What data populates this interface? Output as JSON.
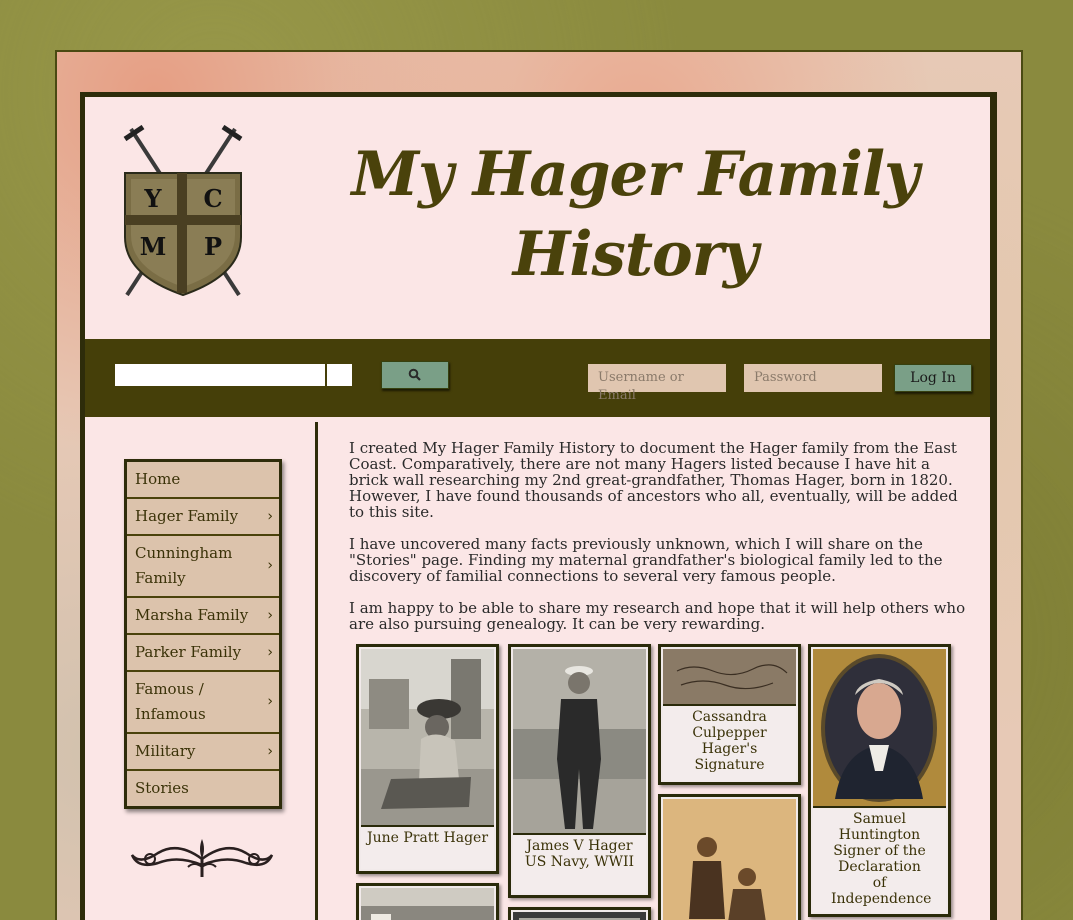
{
  "header": {
    "title": "My Hager Family History",
    "crest_letters": [
      "Y",
      "C",
      "M",
      "P"
    ]
  },
  "toolbar": {
    "search_value": "",
    "username_placeholder": "Username or Email",
    "password_placeholder": "Password",
    "login_label": "Log In"
  },
  "menu": {
    "items": [
      {
        "label": "Home",
        "has_submenu": false
      },
      {
        "label": "Hager Family",
        "has_submenu": true
      },
      {
        "label": "Cunningham Family",
        "has_submenu": true
      },
      {
        "label": "Marsha Family",
        "has_submenu": true
      },
      {
        "label": "Parker Family",
        "has_submenu": true
      },
      {
        "label": "Famous / Infamous",
        "has_submenu": true
      },
      {
        "label": "Military",
        "has_submenu": true
      },
      {
        "label": "Stories",
        "has_submenu": false
      }
    ],
    "submenu_arrow": "›"
  },
  "content": {
    "paragraphs": [
      "I created My Hager Family History to document the Hager family from the East Coast. Comparatively, there are not many Hagers listed because I have hit a brick wall researching my 2nd great-grandfather, Thomas Hager, born in 1820. However, I have found thousands of ancestors who all, eventually, will be added to this site.",
      "I have uncovered many facts previously unknown, which I will share on the \"Stories\" page. Finding my maternal grandfather's biological family led to the discovery of familial connections to several very famous people.",
      "I am happy to be able to share my research and hope that it will help others who are also pursuing genealogy. It can be very rewarding."
    ]
  },
  "gallery": {
    "captions": [
      "June Pratt Hager",
      "James V Hager US Navy, WWII",
      "Cassandra Culpepper Hager's Signature",
      "Samuel Huntington Signer of the Declaration of Independence"
    ]
  },
  "colors": {
    "accent": "#453f09",
    "button": "#7a9f87",
    "page_bg": "#fbe6e6",
    "menu_bg": "#dcc3ac"
  }
}
